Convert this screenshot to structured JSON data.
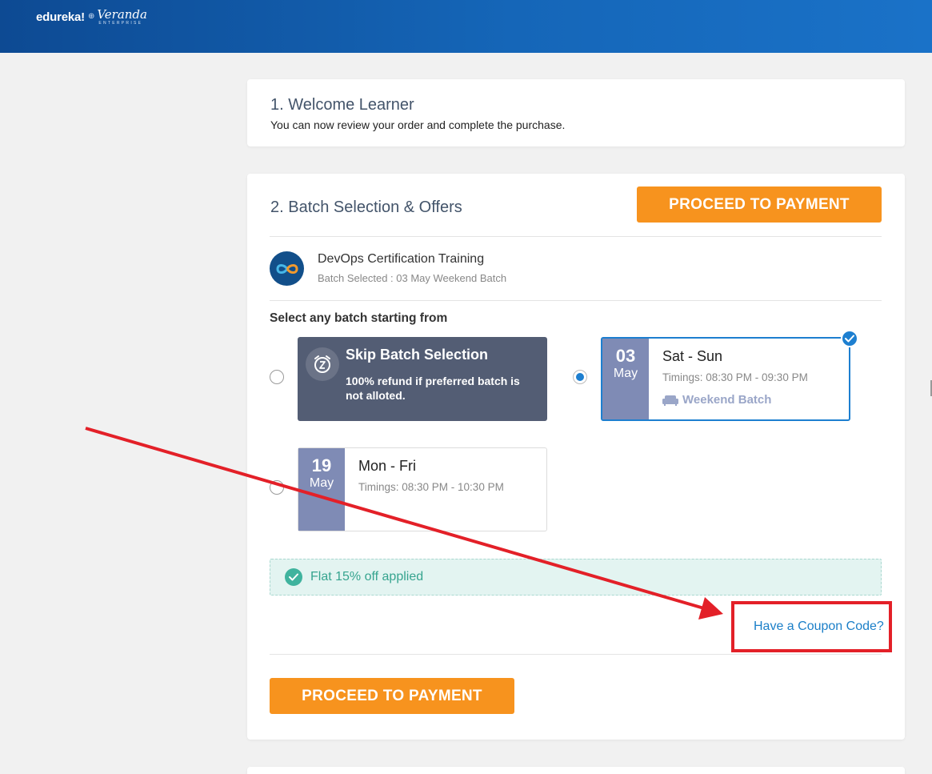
{
  "header": {
    "brand_edureka": "edureka!",
    "brand_separator": "⊕",
    "brand_veranda": "Veranda",
    "brand_enterprise": "ENTERPRISE",
    "gradient_from": "#0d4a93",
    "gradient_to": "#1a72c8"
  },
  "welcome": {
    "title": "1. Welcome Learner",
    "subtitle": "You can now review your order and complete the purchase."
  },
  "batch_section": {
    "title": "2. Batch Selection & Offers",
    "proceed_top_label": "PROCEED TO PAYMENT",
    "course": {
      "name": "DevOps Certification Training",
      "batch_selected": "Batch Selected : 03 May Weekend Batch",
      "logo_icon": "infinity-icon"
    },
    "select_label": "Select any batch starting from",
    "skip_option": {
      "title": "Skip Batch Selection",
      "description": "100% refund if preferred batch is not alloted.",
      "icon": "alarm-clock-icon",
      "selected": false
    },
    "batches": [
      {
        "day": "03",
        "month": "May",
        "days": "Sat - Sun",
        "timings": "Timings: 08:30 PM - 09:30 PM",
        "tag": "Weekend Batch",
        "tag_icon": "sofa-icon",
        "selected": true
      },
      {
        "day": "19",
        "month": "May",
        "days": "Mon - Fri",
        "timings": "Timings: 08:30 PM - 10:30 PM",
        "tag": "",
        "selected": false
      }
    ],
    "offer_text": "Flat 15% off applied",
    "coupon_link": "Have a Coupon Code?",
    "proceed_bottom_label": "PROCEED TO PAYMENT"
  },
  "colors": {
    "accent_orange": "#f7931e",
    "selected_blue": "#1d7fd0",
    "skip_card": "#535d74",
    "date_box": "#7f8bb5",
    "offer_green": "#3fb39e",
    "annotation_red": "#e32028"
  },
  "annotation": {
    "arrow_icon": "red-arrow-annotation",
    "highlight": "red-highlight-box"
  }
}
